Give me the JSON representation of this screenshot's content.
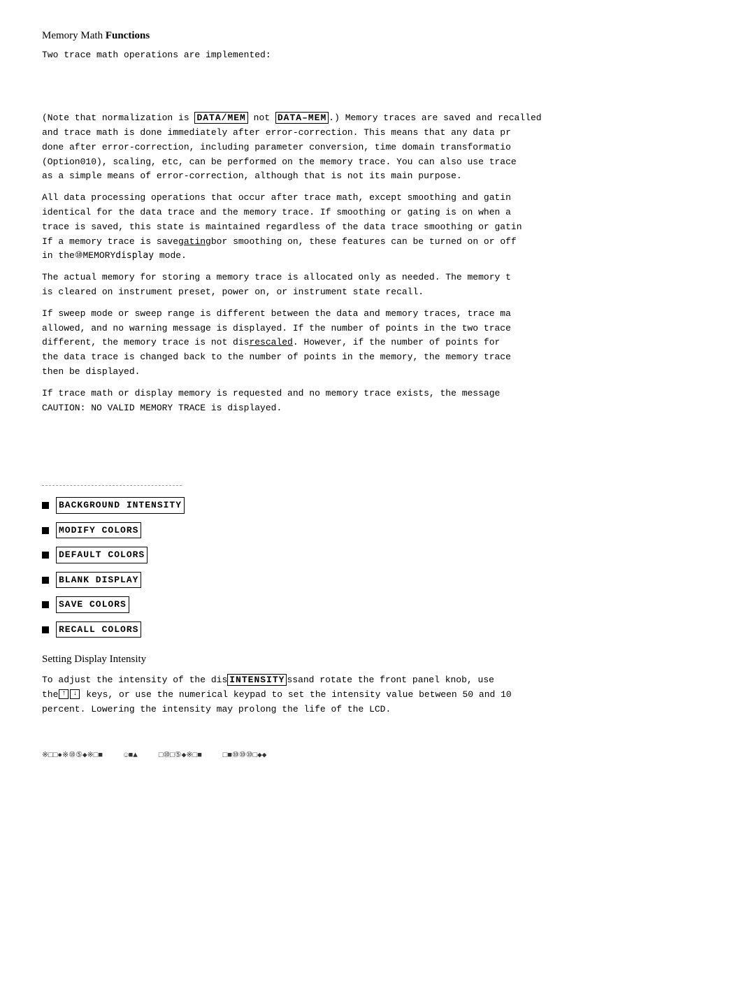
{
  "page": {
    "title": "Memory Math Functions",
    "subtitle_bold": "Functions",
    "intro_line": "Two  trace  math  operations  are  implemented:",
    "paragraphs": [
      "(Note that normalization is DATA/MEM not DATA–MEM.) Memory traces are saved and recalled and trace math is done immediately after error-correction. This means that any data pr done after error-correction, including parameter conversion, time domain transformatio (Option010), scaling, etc, can be performed on the memory trace. You can also use trace as a simple means of error-correction, although that is not its main purpose.",
      "All data processing operations that occur after trace math, except smoothing and gatin identical for the data trace and the memory trace. If smoothing or gating is on when a trace is saved, this state is maintained regardless of the data trace smoothing or gatin If a memory trace is savegatingbor smoothing on, these features can be turned on or off in the MEMORY display mode.",
      "The actual memory for storing a memory trace is allocated only as needed. The memory t is cleared on instrument preset, power on, or instrument state recall.",
      "If sweep mode or sweep range is different between the data and memory traces, trace ma allowed, and no warning message is displayed. If the number of points in the two trace different, the memory trace is not disrescaled. However, if the number of points for the data trace is changed back to the number of points in the memory, the memory trace then be displayed.",
      "If trace math or display memory is requested and no memory trace exists, the message CAUTION: NO VALID MEMORY TRACE is displayed."
    ],
    "menu_items": [
      "BACKGROUND INTENSITY",
      "MODIFY COLORS",
      "DEFAULT COLORS",
      "BLANK DISPLAY",
      "SAVE COLORS",
      "RECALL COLORS"
    ],
    "setting_section_title": "Setting Display Intensity",
    "setting_paragraph": "To adjust the intensity of the disINTENSITY ssand rotate the front panel knob, use the keys, or use the numerical keypad to set the intensity value between 50 and 10 percent. Lowering the intensity may prolong the life of the LCD.",
    "footer": {
      "part1": "※□□●※⑩⑤◆※□■",
      "part2": "☺■▲",
      "part3": "□⑩□⑤◆※□■",
      "part4": "□■⑩⑩⑩□◆◆"
    }
  }
}
